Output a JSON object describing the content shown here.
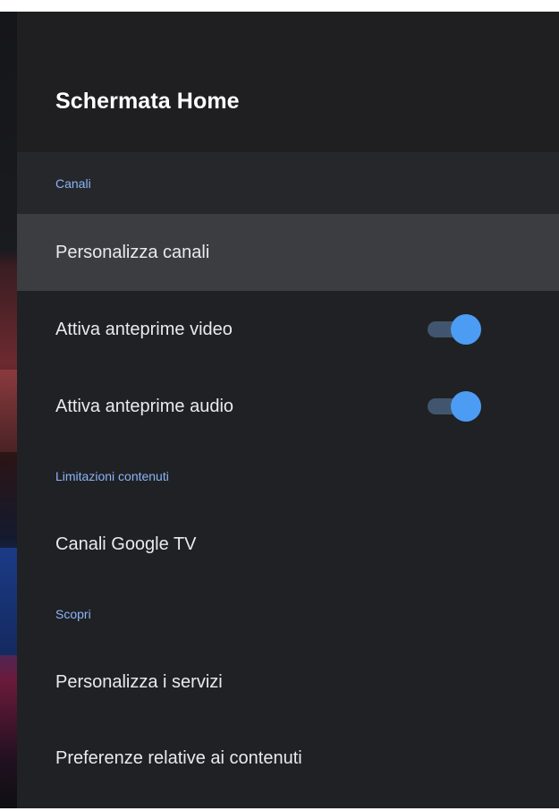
{
  "header": {
    "title": "Schermata Home"
  },
  "sections": [
    {
      "label": "Canali",
      "items": [
        {
          "label": "Personalizza canali",
          "focused": true
        },
        {
          "label": "Attiva anteprime video",
          "toggle": true,
          "enabled": true
        },
        {
          "label": "Attiva anteprime audio",
          "toggle": true,
          "enabled": true
        }
      ]
    },
    {
      "label": "Limitazioni contenuti",
      "items": [
        {
          "label": "Canali Google TV"
        }
      ]
    },
    {
      "label": "Scopri",
      "items": [
        {
          "label": "Personalizza i servizi"
        },
        {
          "label": "Preferenze relative ai contenuti"
        }
      ]
    }
  ],
  "colors": {
    "panel_bg": "#202124",
    "focused_row": "#3c3d40",
    "section_label": "#8ab4f8",
    "toggle_thumb": "#4c9cf4",
    "toggle_track": "#41566e"
  }
}
